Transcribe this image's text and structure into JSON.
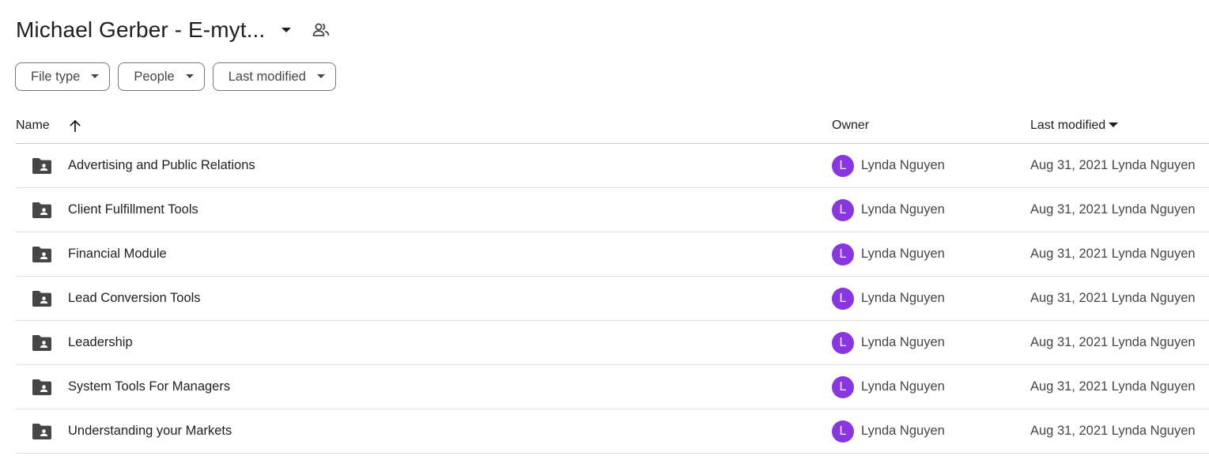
{
  "header": {
    "title": "Michael Gerber - E-myt...",
    "title_menu_icon": "caret-down-icon",
    "shared_icon": "people-icon"
  },
  "filters": [
    {
      "label": "File type",
      "icon": "caret-down-icon"
    },
    {
      "label": "People",
      "icon": "caret-down-icon"
    },
    {
      "label": "Last modified",
      "icon": "caret-down-icon"
    }
  ],
  "table": {
    "columns": {
      "name": "Name",
      "owner": "Owner",
      "last_modified": "Last modified"
    },
    "sort_icon": "arrow-up-icon",
    "rows": [
      {
        "name": "Advertising and Public Relations",
        "owner_initial": "L",
        "owner": "Lynda Nguyen",
        "modified": "Aug 31, 2021 Lynda Nguyen",
        "icon": "shared-folder-icon"
      },
      {
        "name": "Client Fulfillment Tools",
        "owner_initial": "L",
        "owner": "Lynda Nguyen",
        "modified": "Aug 31, 2021 Lynda Nguyen",
        "icon": "shared-folder-icon"
      },
      {
        "name": "Financial Module",
        "owner_initial": "L",
        "owner": "Lynda Nguyen",
        "modified": "Aug 31, 2021 Lynda Nguyen",
        "icon": "shared-folder-icon"
      },
      {
        "name": "Lead Conversion Tools",
        "owner_initial": "L",
        "owner": "Lynda Nguyen",
        "modified": "Aug 31, 2021 Lynda Nguyen",
        "icon": "shared-folder-icon"
      },
      {
        "name": "Leadership",
        "owner_initial": "L",
        "owner": "Lynda Nguyen",
        "modified": "Aug 31, 2021 Lynda Nguyen",
        "icon": "shared-folder-icon"
      },
      {
        "name": "System Tools For Managers",
        "owner_initial": "L",
        "owner": "Lynda Nguyen",
        "modified": "Aug 31, 2021 Lynda Nguyen",
        "icon": "shared-folder-icon"
      },
      {
        "name": "Understanding your Markets",
        "owner_initial": "L",
        "owner": "Lynda Nguyen",
        "modified": "Aug 31, 2021 Lynda Nguyen",
        "icon": "shared-folder-icon"
      }
    ]
  },
  "colors": {
    "avatar": "#8a36e0",
    "text": "#1f1f1f",
    "secondary_text": "#444746",
    "icon": "#444746",
    "divider": "#e0e0e0"
  }
}
